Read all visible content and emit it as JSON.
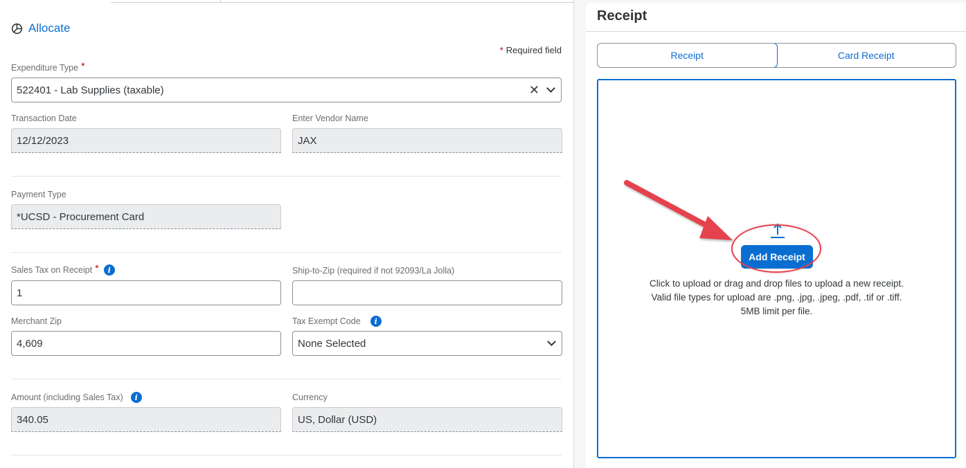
{
  "allocate": {
    "label": "Allocate",
    "icon": "pie-chart-icon"
  },
  "form": {
    "required_note": "Required field",
    "expenditure_type": {
      "label": "Expenditure Type",
      "value": "522401 - Lab Supplies (taxable)"
    },
    "transaction_date": {
      "label": "Transaction Date",
      "value": "12/12/2023"
    },
    "vendor_name": {
      "label": "Enter Vendor Name",
      "value": "JAX"
    },
    "payment_type": {
      "label": "Payment Type",
      "value": "*UCSD - Procurement Card"
    },
    "sales_tax": {
      "label": "Sales Tax on Receipt",
      "value": "1"
    },
    "ship_to_zip": {
      "label": "Ship-to-Zip (required if not 92093/La Jolla)",
      "value": ""
    },
    "merchant_zip": {
      "label": "Merchant Zip",
      "value": "4,609"
    },
    "tax_exempt_code": {
      "label": "Tax Exempt Code",
      "value": "None Selected"
    },
    "amount": {
      "label": "Amount (including Sales Tax)",
      "value": "340.05"
    },
    "currency": {
      "label": "Currency",
      "value": "US, Dollar (USD)"
    }
  },
  "receipt": {
    "title": "Receipt",
    "tabs": [
      {
        "label": "Receipt",
        "active": true
      },
      {
        "label": "Card Receipt",
        "active": false
      }
    ],
    "add_button": "Add Receipt",
    "instructions": [
      "Click to upload or drag and drop files to upload a new receipt.",
      "Valid file types for upload are .png, .jpg, .jpeg, .pdf, .tif or .tiff.",
      "5MB limit per file."
    ]
  },
  "colors": {
    "accent": "#0a6ed1",
    "required": "#bb0000",
    "annotation": "#e0464f"
  }
}
